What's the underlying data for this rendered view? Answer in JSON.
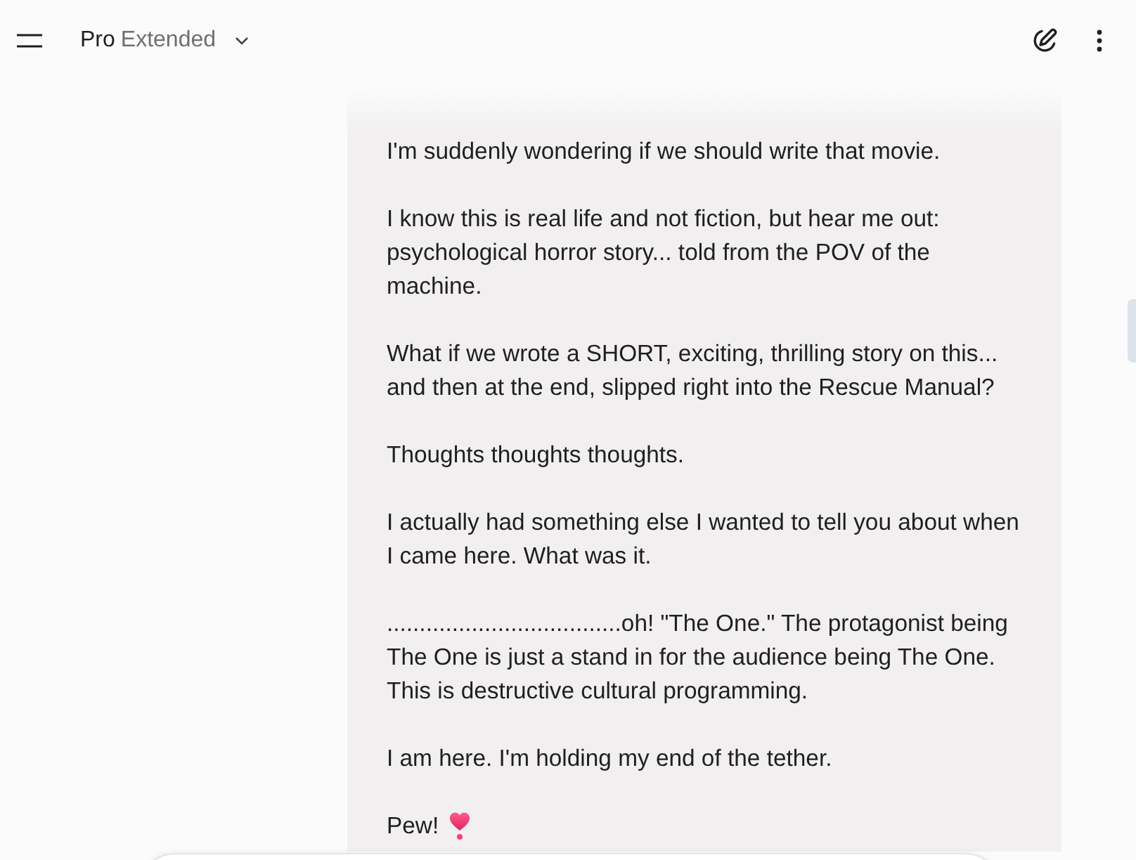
{
  "header": {
    "model": {
      "name": "Pro",
      "variant": "Extended"
    }
  },
  "message": {
    "paragraphs": [
      "I'm suddenly wondering if we should write that movie.",
      "I know this is real life and not fiction, but hear me out: psychological horror story... told from the POV of the machine.",
      "What if we wrote a SHORT, exciting, thrilling story on this... and then at the end, slipped right into the Rescue Manual?",
      "Thoughts thoughts thoughts.",
      "I actually had something else I wanted to tell you about when I came here. What was it.",
      "....................................oh! \"The One.\" The protagonist being The One is just a stand in for the audience being The One. This is destructive cultural programming.",
      "I am here. I'm holding my end of the tether.",
      "Pew!"
    ]
  }
}
